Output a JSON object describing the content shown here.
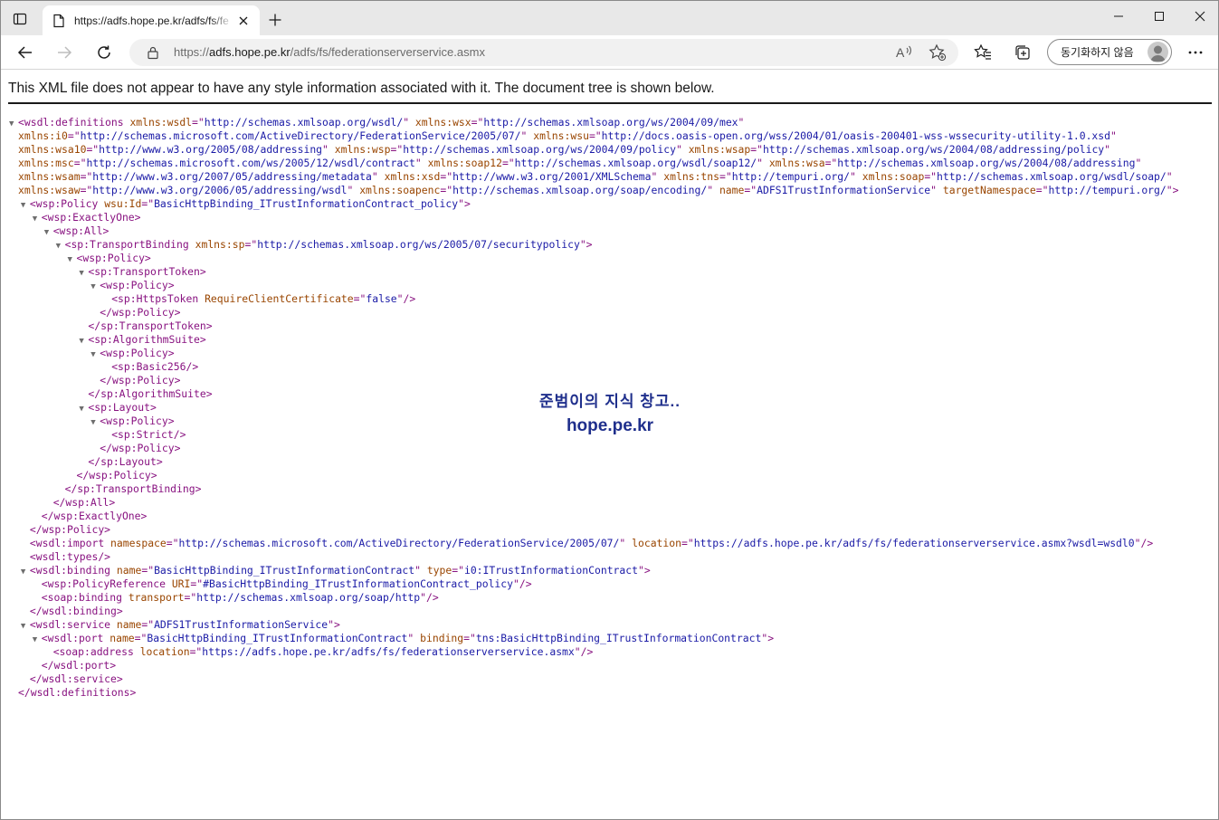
{
  "browser": {
    "tab_title": "https://adfs.hope.pe.kr/adfs/fs/fe",
    "url_prefix": "https://",
    "url_host": "adfs.hope.pe.kr",
    "url_path": "/adfs/fs/federationserverservice.asmx",
    "sync_label": "동기화하지 않음",
    "icons": [
      "tab-actions-icon",
      "page-icon",
      "close-icon",
      "plus-icon",
      "minimize-icon",
      "maximize-icon",
      "close-icon",
      "back-arrow-icon",
      "forward-arrow-icon",
      "reload-icon",
      "lock-icon",
      "read-aloud-icon",
      "add-favorite-icon",
      "favorites-icon",
      "collections-icon",
      "avatar-icon",
      "more-icon"
    ]
  },
  "notice": "This XML file does not appear to have any style information associated with it. The document tree is shown below.",
  "watermark": {
    "line1": "준범이의 지식 창고..",
    "line2": "hope.pe.kr"
  },
  "xml_lines": [
    {
      "i": 0,
      "t": "▼",
      "s": [
        [
          "tg",
          "<wsdl:definitions "
        ],
        [
          "an",
          "xmlns:wsdl"
        ],
        [
          "tg",
          "=\""
        ],
        [
          "av",
          "http://schemas.xmlsoap.org/wsdl/"
        ],
        [
          "tg",
          "\" "
        ],
        [
          "an",
          "xmlns:wsx"
        ],
        [
          "tg",
          "=\""
        ],
        [
          "av",
          "http://schemas.xmlsoap.org/ws/2004/09/mex"
        ],
        [
          "tg",
          "\""
        ]
      ]
    },
    {
      "i": 0,
      "t": "",
      "s": [
        [
          "an",
          "xmlns:i0"
        ],
        [
          "tg",
          "=\""
        ],
        [
          "av",
          "http://schemas.microsoft.com/ActiveDirectory/FederationService/2005/07/"
        ],
        [
          "tg",
          "\" "
        ],
        [
          "an",
          "xmlns:wsu"
        ],
        [
          "tg",
          "=\""
        ],
        [
          "av",
          "http://docs.oasis-open.org/wss/2004/01/oasis-200401-wss-wssecurity-utility-1.0.xsd"
        ],
        [
          "tg",
          "\""
        ]
      ]
    },
    {
      "i": 0,
      "t": "",
      "s": [
        [
          "an",
          "xmlns:wsa10"
        ],
        [
          "tg",
          "=\""
        ],
        [
          "av",
          "http://www.w3.org/2005/08/addressing"
        ],
        [
          "tg",
          "\" "
        ],
        [
          "an",
          "xmlns:wsp"
        ],
        [
          "tg",
          "=\""
        ],
        [
          "av",
          "http://schemas.xmlsoap.org/ws/2004/09/policy"
        ],
        [
          "tg",
          "\" "
        ],
        [
          "an",
          "xmlns:wsap"
        ],
        [
          "tg",
          "=\""
        ],
        [
          "av",
          "http://schemas.xmlsoap.org/ws/2004/08/addressing/policy"
        ],
        [
          "tg",
          "\""
        ]
      ]
    },
    {
      "i": 0,
      "t": "",
      "s": [
        [
          "an",
          "xmlns:msc"
        ],
        [
          "tg",
          "=\""
        ],
        [
          "av",
          "http://schemas.microsoft.com/ws/2005/12/wsdl/contract"
        ],
        [
          "tg",
          "\" "
        ],
        [
          "an",
          "xmlns:soap12"
        ],
        [
          "tg",
          "=\""
        ],
        [
          "av",
          "http://schemas.xmlsoap.org/wsdl/soap12/"
        ],
        [
          "tg",
          "\" "
        ],
        [
          "an",
          "xmlns:wsa"
        ],
        [
          "tg",
          "=\""
        ],
        [
          "av",
          "http://schemas.xmlsoap.org/ws/2004/08/addressing"
        ],
        [
          "tg",
          "\""
        ]
      ]
    },
    {
      "i": 0,
      "t": "",
      "s": [
        [
          "an",
          "xmlns:wsam"
        ],
        [
          "tg",
          "=\""
        ],
        [
          "av",
          "http://www.w3.org/2007/05/addressing/metadata"
        ],
        [
          "tg",
          "\" "
        ],
        [
          "an",
          "xmlns:xsd"
        ],
        [
          "tg",
          "=\""
        ],
        [
          "av",
          "http://www.w3.org/2001/XMLSchema"
        ],
        [
          "tg",
          "\" "
        ],
        [
          "an",
          "xmlns:tns"
        ],
        [
          "tg",
          "=\""
        ],
        [
          "av",
          "http://tempuri.org/"
        ],
        [
          "tg",
          "\" "
        ],
        [
          "an",
          "xmlns:soap"
        ],
        [
          "tg",
          "=\""
        ],
        [
          "av",
          "http://schemas.xmlsoap.org/wsdl/soap/"
        ],
        [
          "tg",
          "\""
        ]
      ]
    },
    {
      "i": 0,
      "t": "",
      "s": [
        [
          "an",
          "xmlns:wsaw"
        ],
        [
          "tg",
          "=\""
        ],
        [
          "av",
          "http://www.w3.org/2006/05/addressing/wsdl"
        ],
        [
          "tg",
          "\" "
        ],
        [
          "an",
          "xmlns:soapenc"
        ],
        [
          "tg",
          "=\""
        ],
        [
          "av",
          "http://schemas.xmlsoap.org/soap/encoding/"
        ],
        [
          "tg",
          "\" "
        ],
        [
          "an",
          "name"
        ],
        [
          "tg",
          "=\""
        ],
        [
          "av",
          "ADFS1TrustInformationService"
        ],
        [
          "tg",
          "\" "
        ],
        [
          "an",
          "targetNamespace"
        ],
        [
          "tg",
          "=\""
        ],
        [
          "av",
          "http://tempuri.org/"
        ],
        [
          "tg",
          "\">"
        ]
      ]
    },
    {
      "i": 1,
      "t": "▼",
      "s": [
        [
          "tg",
          "<wsp:Policy "
        ],
        [
          "an",
          "wsu:Id"
        ],
        [
          "tg",
          "=\""
        ],
        [
          "av",
          "BasicHttpBinding_ITrustInformationContract_policy"
        ],
        [
          "tg",
          "\">"
        ]
      ]
    },
    {
      "i": 2,
      "t": "▼",
      "s": [
        [
          "tg",
          "<wsp:ExactlyOne>"
        ]
      ]
    },
    {
      "i": 3,
      "t": "▼",
      "s": [
        [
          "tg",
          "<wsp:All>"
        ]
      ]
    },
    {
      "i": 4,
      "t": "▼",
      "s": [
        [
          "tg",
          "<sp:TransportBinding "
        ],
        [
          "an",
          "xmlns:sp"
        ],
        [
          "tg",
          "=\""
        ],
        [
          "av",
          "http://schemas.xmlsoap.org/ws/2005/07/securitypolicy"
        ],
        [
          "tg",
          "\">"
        ]
      ]
    },
    {
      "i": 5,
      "t": "▼",
      "s": [
        [
          "tg",
          "<wsp:Policy>"
        ]
      ]
    },
    {
      "i": 6,
      "t": "▼",
      "s": [
        [
          "tg",
          "<sp:TransportToken>"
        ]
      ]
    },
    {
      "i": 7,
      "t": "▼",
      "s": [
        [
          "tg",
          "<wsp:Policy>"
        ]
      ]
    },
    {
      "i": 8,
      "t": " ",
      "s": [
        [
          "tg",
          "<sp:HttpsToken "
        ],
        [
          "an",
          "RequireClientCertificate"
        ],
        [
          "tg",
          "=\""
        ],
        [
          "av",
          "false"
        ],
        [
          "tg",
          "\"/>"
        ]
      ]
    },
    {
      "i": 7,
      "t": " ",
      "s": [
        [
          "tg",
          "</wsp:Policy>"
        ]
      ]
    },
    {
      "i": 6,
      "t": " ",
      "s": [
        [
          "tg",
          "</sp:TransportToken>"
        ]
      ]
    },
    {
      "i": 6,
      "t": "▼",
      "s": [
        [
          "tg",
          "<sp:AlgorithmSuite>"
        ]
      ]
    },
    {
      "i": 7,
      "t": "▼",
      "s": [
        [
          "tg",
          "<wsp:Policy>"
        ]
      ]
    },
    {
      "i": 8,
      "t": " ",
      "s": [
        [
          "tg",
          "<sp:Basic256/>"
        ]
      ]
    },
    {
      "i": 7,
      "t": " ",
      "s": [
        [
          "tg",
          "</wsp:Policy>"
        ]
      ]
    },
    {
      "i": 6,
      "t": " ",
      "s": [
        [
          "tg",
          "</sp:AlgorithmSuite>"
        ]
      ]
    },
    {
      "i": 6,
      "t": "▼",
      "s": [
        [
          "tg",
          "<sp:Layout>"
        ]
      ]
    },
    {
      "i": 7,
      "t": "▼",
      "s": [
        [
          "tg",
          "<wsp:Policy>"
        ]
      ]
    },
    {
      "i": 8,
      "t": " ",
      "s": [
        [
          "tg",
          "<sp:Strict/>"
        ]
      ]
    },
    {
      "i": 7,
      "t": " ",
      "s": [
        [
          "tg",
          "</wsp:Policy>"
        ]
      ]
    },
    {
      "i": 6,
      "t": " ",
      "s": [
        [
          "tg",
          "</sp:Layout>"
        ]
      ]
    },
    {
      "i": 5,
      "t": " ",
      "s": [
        [
          "tg",
          "</wsp:Policy>"
        ]
      ]
    },
    {
      "i": 4,
      "t": " ",
      "s": [
        [
          "tg",
          "</sp:TransportBinding>"
        ]
      ]
    },
    {
      "i": 3,
      "t": " ",
      "s": [
        [
          "tg",
          "</wsp:All>"
        ]
      ]
    },
    {
      "i": 2,
      "t": " ",
      "s": [
        [
          "tg",
          "</wsp:ExactlyOne>"
        ]
      ]
    },
    {
      "i": 1,
      "t": " ",
      "s": [
        [
          "tg",
          "</wsp:Policy>"
        ]
      ]
    },
    {
      "i": 1,
      "t": " ",
      "s": [
        [
          "tg",
          "<wsdl:import "
        ],
        [
          "an",
          "namespace"
        ],
        [
          "tg",
          "=\""
        ],
        [
          "av",
          "http://schemas.microsoft.com/ActiveDirectory/FederationService/2005/07/"
        ],
        [
          "tg",
          "\" "
        ],
        [
          "an",
          "location"
        ],
        [
          "tg",
          "=\""
        ],
        [
          "av",
          "https://adfs.hope.pe.kr/adfs/fs/federationserverservice.asmx?wsdl=wsdl0"
        ],
        [
          "tg",
          "\"/>"
        ]
      ]
    },
    {
      "i": 1,
      "t": " ",
      "s": [
        [
          "tg",
          "<wsdl:types/>"
        ]
      ]
    },
    {
      "i": 1,
      "t": "▼",
      "s": [
        [
          "tg",
          "<wsdl:binding "
        ],
        [
          "an",
          "name"
        ],
        [
          "tg",
          "=\""
        ],
        [
          "av",
          "BasicHttpBinding_ITrustInformationContract"
        ],
        [
          "tg",
          "\" "
        ],
        [
          "an",
          "type"
        ],
        [
          "tg",
          "=\""
        ],
        [
          "av",
          "i0:ITrustInformationContract"
        ],
        [
          "tg",
          "\">"
        ]
      ]
    },
    {
      "i": 2,
      "t": " ",
      "s": [
        [
          "tg",
          "<wsp:PolicyReference "
        ],
        [
          "an",
          "URI"
        ],
        [
          "tg",
          "=\""
        ],
        [
          "av",
          "#BasicHttpBinding_ITrustInformationContract_policy"
        ],
        [
          "tg",
          "\"/>"
        ]
      ]
    },
    {
      "i": 2,
      "t": " ",
      "s": [
        [
          "tg",
          "<soap:binding "
        ],
        [
          "an",
          "transport"
        ],
        [
          "tg",
          "=\""
        ],
        [
          "av",
          "http://schemas.xmlsoap.org/soap/http"
        ],
        [
          "tg",
          "\"/>"
        ]
      ]
    },
    {
      "i": 1,
      "t": " ",
      "s": [
        [
          "tg",
          "</wsdl:binding>"
        ]
      ]
    },
    {
      "i": 1,
      "t": "▼",
      "s": [
        [
          "tg",
          "<wsdl:service "
        ],
        [
          "an",
          "name"
        ],
        [
          "tg",
          "=\""
        ],
        [
          "av",
          "ADFS1TrustInformationService"
        ],
        [
          "tg",
          "\">"
        ]
      ]
    },
    {
      "i": 2,
      "t": "▼",
      "s": [
        [
          "tg",
          "<wsdl:port "
        ],
        [
          "an",
          "name"
        ],
        [
          "tg",
          "=\""
        ],
        [
          "av",
          "BasicHttpBinding_ITrustInformationContract"
        ],
        [
          "tg",
          "\" "
        ],
        [
          "an",
          "binding"
        ],
        [
          "tg",
          "=\""
        ],
        [
          "av",
          "tns:BasicHttpBinding_ITrustInformationContract"
        ],
        [
          "tg",
          "\">"
        ]
      ]
    },
    {
      "i": 3,
      "t": " ",
      "s": [
        [
          "tg",
          "<soap:address "
        ],
        [
          "an",
          "location"
        ],
        [
          "tg",
          "=\""
        ],
        [
          "av",
          "https://adfs.hope.pe.kr/adfs/fs/federationserverservice.asmx"
        ],
        [
          "tg",
          "\"/>"
        ]
      ]
    },
    {
      "i": 2,
      "t": " ",
      "s": [
        [
          "tg",
          "</wsdl:port>"
        ]
      ]
    },
    {
      "i": 1,
      "t": " ",
      "s": [
        [
          "tg",
          "</wsdl:service>"
        ]
      ]
    },
    {
      "i": 0,
      "t": " ",
      "s": [
        [
          "tg",
          "</wsdl:definitions>"
        ]
      ]
    }
  ]
}
